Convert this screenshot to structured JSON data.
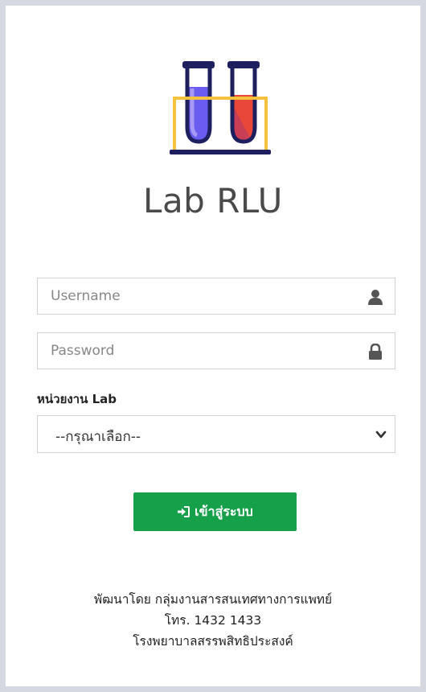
{
  "app": {
    "title": "Lab RLU"
  },
  "logo": {
    "icon": "test-tubes-icon",
    "colors": {
      "tube_outline": "#1d1f5e",
      "liquid_left": "#6a5cf0",
      "liquid_right": "#e8473a",
      "rack": "#f5c23e"
    }
  },
  "form": {
    "username": {
      "placeholder": "Username",
      "value": "",
      "icon": "user-icon"
    },
    "password": {
      "placeholder": "Password",
      "value": "",
      "icon": "lock-icon"
    },
    "lab_select": {
      "label": "หน่วยงาน Lab",
      "selected": "--กรุณาเลือก--",
      "icon": "chevron-down-icon"
    },
    "submit": {
      "label": "เข้าสู่ระบบ",
      "icon": "sign-in-icon",
      "color": "#17a04a"
    }
  },
  "footer": {
    "developer": "พัฒนาโดย กลุ่มงานสารสนเทศทางการแพทย์",
    "phone": "โทร. 1432 1433",
    "hospital": "โรงพยาบาลสรรพสิทธิประสงค์"
  }
}
